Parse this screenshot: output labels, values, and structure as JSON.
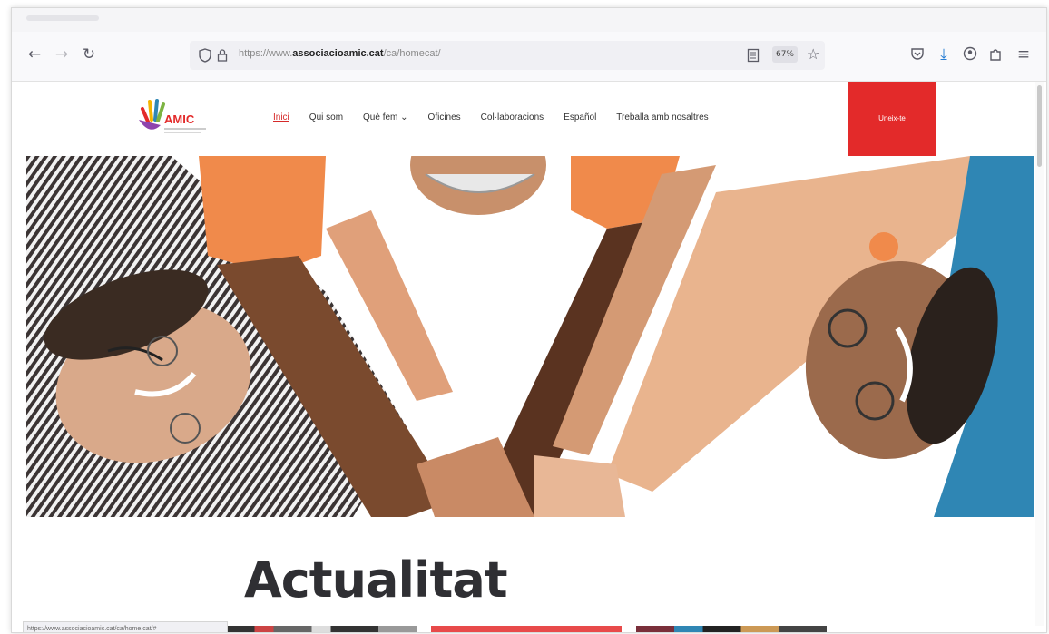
{
  "browser": {
    "url_prefix": "https://www.",
    "url_domain": "associacioamic.cat",
    "url_path": "/ca/homecat/",
    "zoom": "67%",
    "status_url": "https://www.associacioamic.cat/ca/home.cat/#"
  },
  "site": {
    "logo_text": "AMIC",
    "nav": [
      {
        "label": "Inici",
        "active": true
      },
      {
        "label": "Qui som"
      },
      {
        "label": "Què fem ⌄"
      },
      {
        "label": "Oficines"
      },
      {
        "label": "Col·laboracions"
      },
      {
        "label": "Español"
      },
      {
        "label": "Treballa amb nosaltres"
      }
    ],
    "join_label": "Uneix-te",
    "section_title": "Actualitat"
  },
  "colors": {
    "accent_red": "#e32a2a",
    "orange": "#f08a4b",
    "teal": "#2f86b4"
  },
  "icons": [
    "back-icon",
    "forward-icon",
    "reload-icon",
    "shield-icon",
    "lock-icon",
    "reader-icon",
    "star-icon",
    "pocket-icon",
    "download-icon",
    "account-icon",
    "extensions-icon",
    "menu-icon"
  ]
}
